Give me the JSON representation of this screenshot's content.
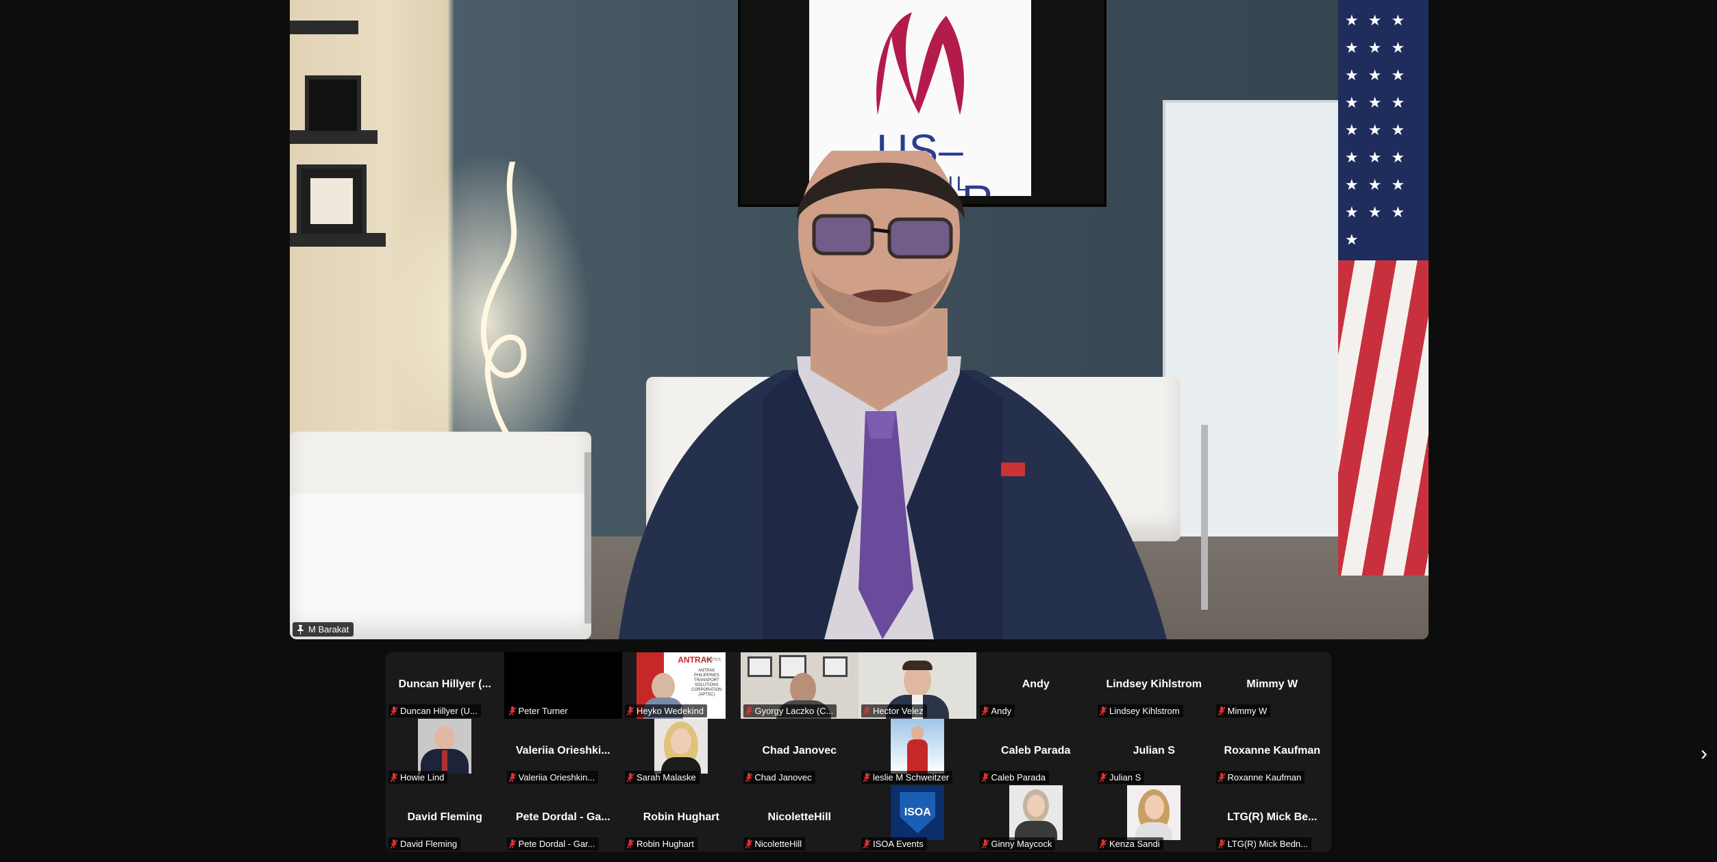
{
  "speaker": {
    "name": "M Barakat",
    "tv_logo_text": "US–QATAR",
    "tv_logo_sub": "BU    NCIL"
  },
  "gallery": {
    "tiles": [
      {
        "display": "Duncan Hillyer (...",
        "label": "Duncan Hillyer (U...",
        "kind": "name"
      },
      {
        "display": "",
        "label": "Peter Turner",
        "kind": "black"
      },
      {
        "display": "",
        "label": "Heyko Wedekind",
        "kind": "antrak"
      },
      {
        "display": "",
        "label": "Gyorgy Laczko (C...",
        "kind": "video1"
      },
      {
        "display": "",
        "label": "Hector Velez",
        "kind": "video2"
      },
      {
        "display": "Andy",
        "label": "Andy",
        "kind": "name"
      },
      {
        "display": "Lindsey Kihlstrom",
        "label": "Lindsey Kihlstrom",
        "kind": "name"
      },
      {
        "display": "Mimmy W",
        "label": "Mimmy W",
        "kind": "name"
      },
      {
        "display": "",
        "label": "Howie Lind",
        "kind": "photo-suit"
      },
      {
        "display": "Valeriia  Orieshki...",
        "label": "Valeriia Orieshkin...",
        "kind": "name"
      },
      {
        "display": "",
        "label": "Sarah Malaske",
        "kind": "photo-blonde"
      },
      {
        "display": "Chad Janovec",
        "label": "Chad Janovec",
        "kind": "name"
      },
      {
        "display": "",
        "label": "leslie  M Schweitzer",
        "kind": "photo-snow"
      },
      {
        "display": "Caleb Parada",
        "label": "Caleb Parada",
        "kind": "name"
      },
      {
        "display": "Julian S",
        "label": "Julian S",
        "kind": "name"
      },
      {
        "display": "Roxanne Kaufman",
        "label": "Roxanne Kaufman",
        "kind": "name"
      },
      {
        "display": "David Fleming",
        "label": "David Fleming",
        "kind": "name"
      },
      {
        "display": "Pete Dordal - Ga...",
        "label": "Pete Dordal - Gar...",
        "kind": "name"
      },
      {
        "display": "Robin Hughart",
        "label": "Robin Hughart",
        "kind": "name"
      },
      {
        "display": "NicoletteHill",
        "label": "NicoletteHill",
        "kind": "name"
      },
      {
        "display": "",
        "label": "ISOA Events",
        "kind": "isoa"
      },
      {
        "display": "",
        "label": "Ginny Maycock",
        "kind": "photo-gray"
      },
      {
        "display": "",
        "label": "Kenza Sandi",
        "kind": "photo-kenza"
      },
      {
        "display": "LTG(R)  Mick Be...",
        "label": "LTG(R) Mick Bedn...",
        "kind": "name"
      }
    ],
    "next_icon": "›"
  },
  "thumb_text": {
    "antrak_brand": "ANTRAK",
    "antrak_small": "LOGISTICS",
    "antrak_body": "ANTRAK\nPHILIPPINES\nTRANSPORT\nSOLUTIONS\nCORPORATION\n(APTSC)",
    "isoa": "ISOA"
  },
  "colors": {
    "muted_mic": "#e0312f",
    "gallery_bg": "#1a1a1a",
    "page_bg": "#0d0d0d"
  }
}
